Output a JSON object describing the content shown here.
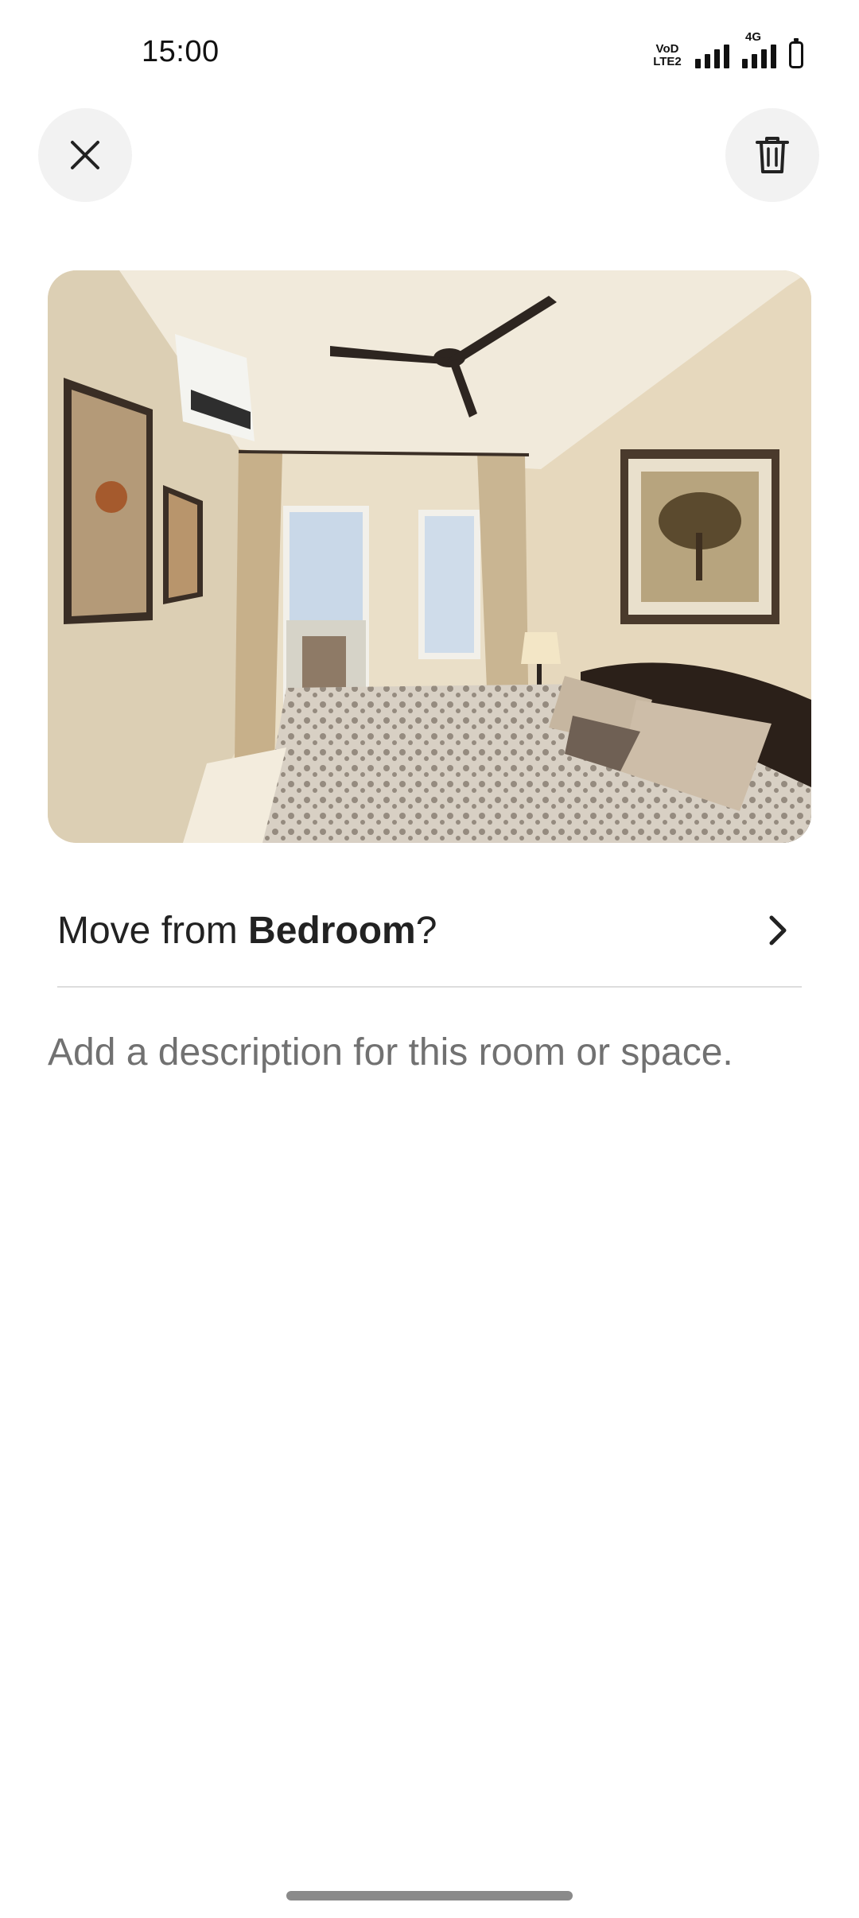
{
  "status_bar": {
    "time": "15:00",
    "volte_label": "VoD\nLTE2",
    "network_label": "4G",
    "icons": [
      "volte-icon",
      "signal-icon",
      "signal-4g-icon",
      "battery-icon"
    ]
  },
  "toolbar": {
    "close_icon": "close-icon",
    "delete_icon": "trash-icon"
  },
  "photo": {
    "subject": "bedroom-photo"
  },
  "move_row": {
    "prefix": "Move from ",
    "room": "Bedroom",
    "suffix": "?",
    "icon": "chevron-right-icon"
  },
  "description": {
    "placeholder": "Add a description for this room or space.",
    "value": ""
  },
  "colors": {
    "text": "#222222",
    "placeholder": "#717171",
    "button_bg": "#f2f2f2",
    "divider": "#dddddd"
  }
}
